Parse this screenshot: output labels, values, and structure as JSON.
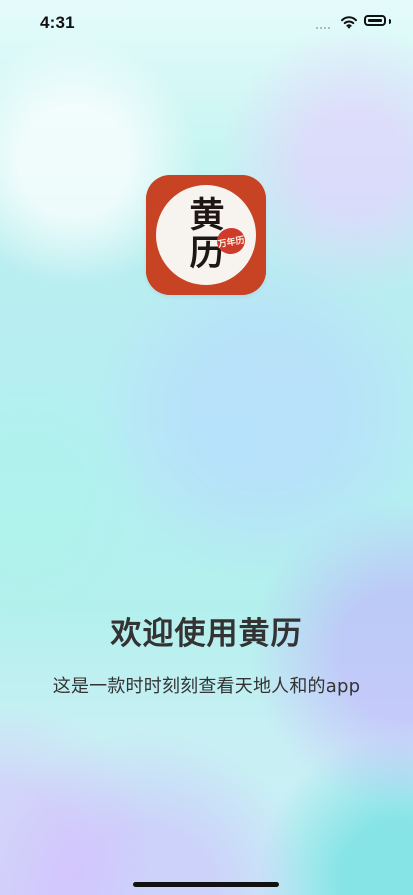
{
  "status_bar": {
    "time": "4:31",
    "signal_icon": "signal-icon",
    "wifi_icon": "wifi-icon",
    "battery_icon": "battery-icon"
  },
  "logo": {
    "main_text": "黄历",
    "seal_text": "万年历",
    "background_color": "#c74324",
    "inner_color": "#f7f4ef"
  },
  "welcome": {
    "title": "欢迎使用黄历",
    "subtitle": "这是一款时时刻刻查看天地人和的app"
  }
}
